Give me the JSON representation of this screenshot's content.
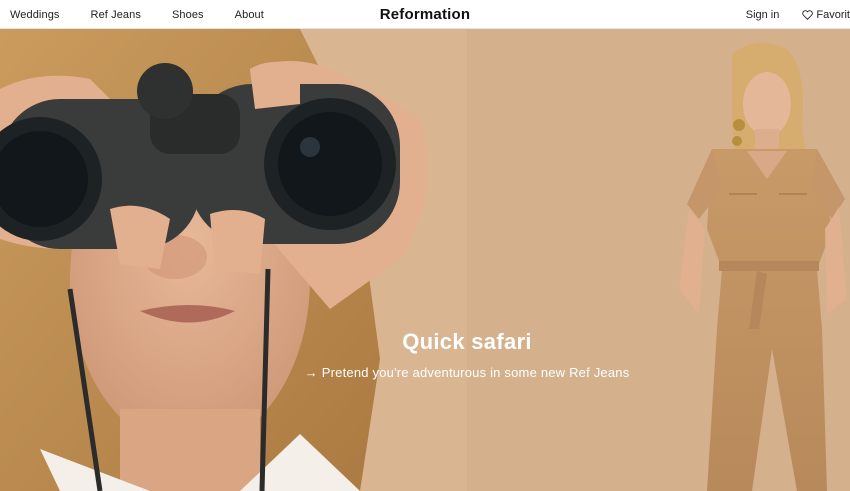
{
  "header": {
    "nav_left": [
      "Weddings",
      "Ref Jeans",
      "Shoes",
      "About"
    ],
    "brand": "Reformation",
    "sign_in": "Sign in",
    "favorites": "Favorit"
  },
  "hero": {
    "headline": "Quick safari",
    "sub_arrow": "→",
    "subline": "Pretend you're adventurous in some new Ref Jeans"
  },
  "colors": {
    "hero_left_bg": "#d9b591",
    "hero_right_bg": "#d4b08c",
    "header_bg": "#ffffff",
    "text_dark": "#1a1a1a",
    "overlay_text": "#ffffff"
  },
  "icons": {
    "favorites": "heart-outline-icon"
  }
}
